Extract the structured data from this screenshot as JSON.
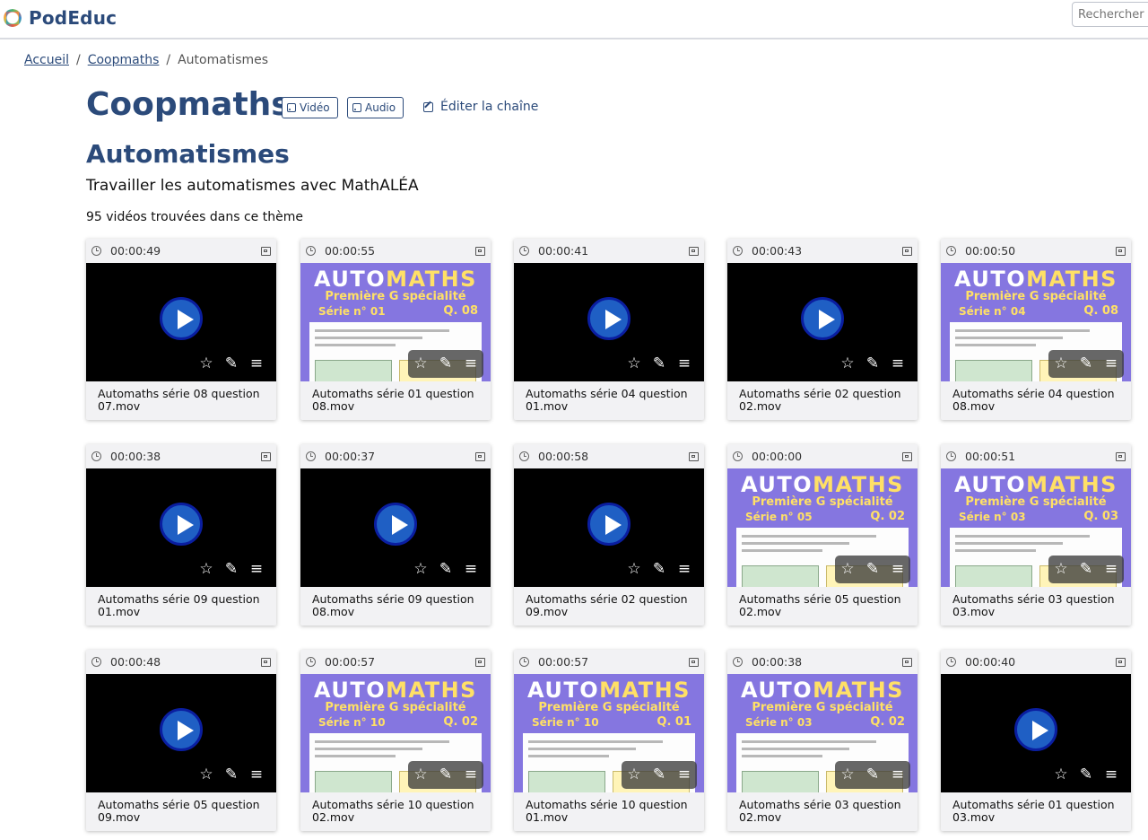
{
  "header": {
    "logo_text": "PodEduc",
    "search_placeholder": "Rechercher une vidéo"
  },
  "breadcrumb": {
    "items": [
      "Accueil",
      "Coopmaths",
      "Automatismes"
    ],
    "separator": "/"
  },
  "channel": {
    "title": "Coopmaths",
    "rss_video": "Vidéo",
    "rss_audio": "Audio",
    "edit_label": "Éditer la chaîne"
  },
  "theme": {
    "title": "Automatismes",
    "description": "Travailler les automatismes avec MathALÉA",
    "count": "95 vidéos trouvées dans ce thème"
  },
  "colors": {
    "brand": "#2b4a7a",
    "thumb_purple": "#8576e0",
    "automaths_yellow": "#ffe066"
  },
  "icons": {
    "duration": "clock-icon",
    "type": "film-icon",
    "favorite": "star-icon",
    "edit": "edit-icon",
    "menu": "menu-icon"
  },
  "videos": [
    {
      "duration": "00:00:49",
      "title": "Automaths série 08 question 07.mov",
      "thumb": "dark"
    },
    {
      "duration": "00:00:55",
      "title": "Automaths série 01 question 08.mov",
      "thumb": "automaths",
      "serie": "Série n° 01",
      "q": "Q. 08"
    },
    {
      "duration": "00:00:41",
      "title": "Automaths série 04 question 01.mov",
      "thumb": "dark"
    },
    {
      "duration": "00:00:43",
      "title": "Automaths série 02 question 02.mov",
      "thumb": "dark"
    },
    {
      "duration": "00:00:50",
      "title": "Automaths série 04 question 08.mov",
      "thumb": "automaths",
      "serie": "Série n° 04",
      "q": "Q. 08"
    },
    {
      "duration": "00:00:38",
      "title": "Automaths série 09 question 01.mov",
      "thumb": "dark"
    },
    {
      "duration": "00:00:37",
      "title": "Automaths série 09 question 08.mov",
      "thumb": "dark"
    },
    {
      "duration": "00:00:58",
      "title": "Automaths série 02 question 09.mov",
      "thumb": "dark"
    },
    {
      "duration": "00:00:00",
      "title": "Automaths série 05 question 02.mov",
      "thumb": "automaths",
      "serie": "Série n° 05",
      "q": "Q. 02"
    },
    {
      "duration": "00:00:51",
      "title": "Automaths série 03 question 03.mov",
      "thumb": "automaths",
      "serie": "Série n° 03",
      "q": "Q. 03"
    },
    {
      "duration": "00:00:48",
      "title": "Automaths série 05 question 09.mov",
      "thumb": "dark"
    },
    {
      "duration": "00:00:57",
      "title": "Automaths série 10 question 02.mov",
      "thumb": "automaths",
      "serie": "Série n° 10",
      "q": "Q. 02"
    },
    {
      "duration": "00:00:57",
      "title": "Automaths série 10 question 01.mov",
      "thumb": "automaths",
      "serie": "Série n° 10",
      "q": "Q. 01"
    },
    {
      "duration": "00:00:38",
      "title": "Automaths série 03 question 02.mov",
      "thumb": "automaths",
      "serie": "Série n° 03",
      "q": "Q. 02"
    },
    {
      "duration": "00:00:40",
      "title": "Automaths série 01 question 03.mov",
      "thumb": "dark"
    }
  ],
  "automaths_banner": {
    "auto": "AUTO",
    "maths": "MATHS",
    "subtitle": "Première G spécialité"
  }
}
